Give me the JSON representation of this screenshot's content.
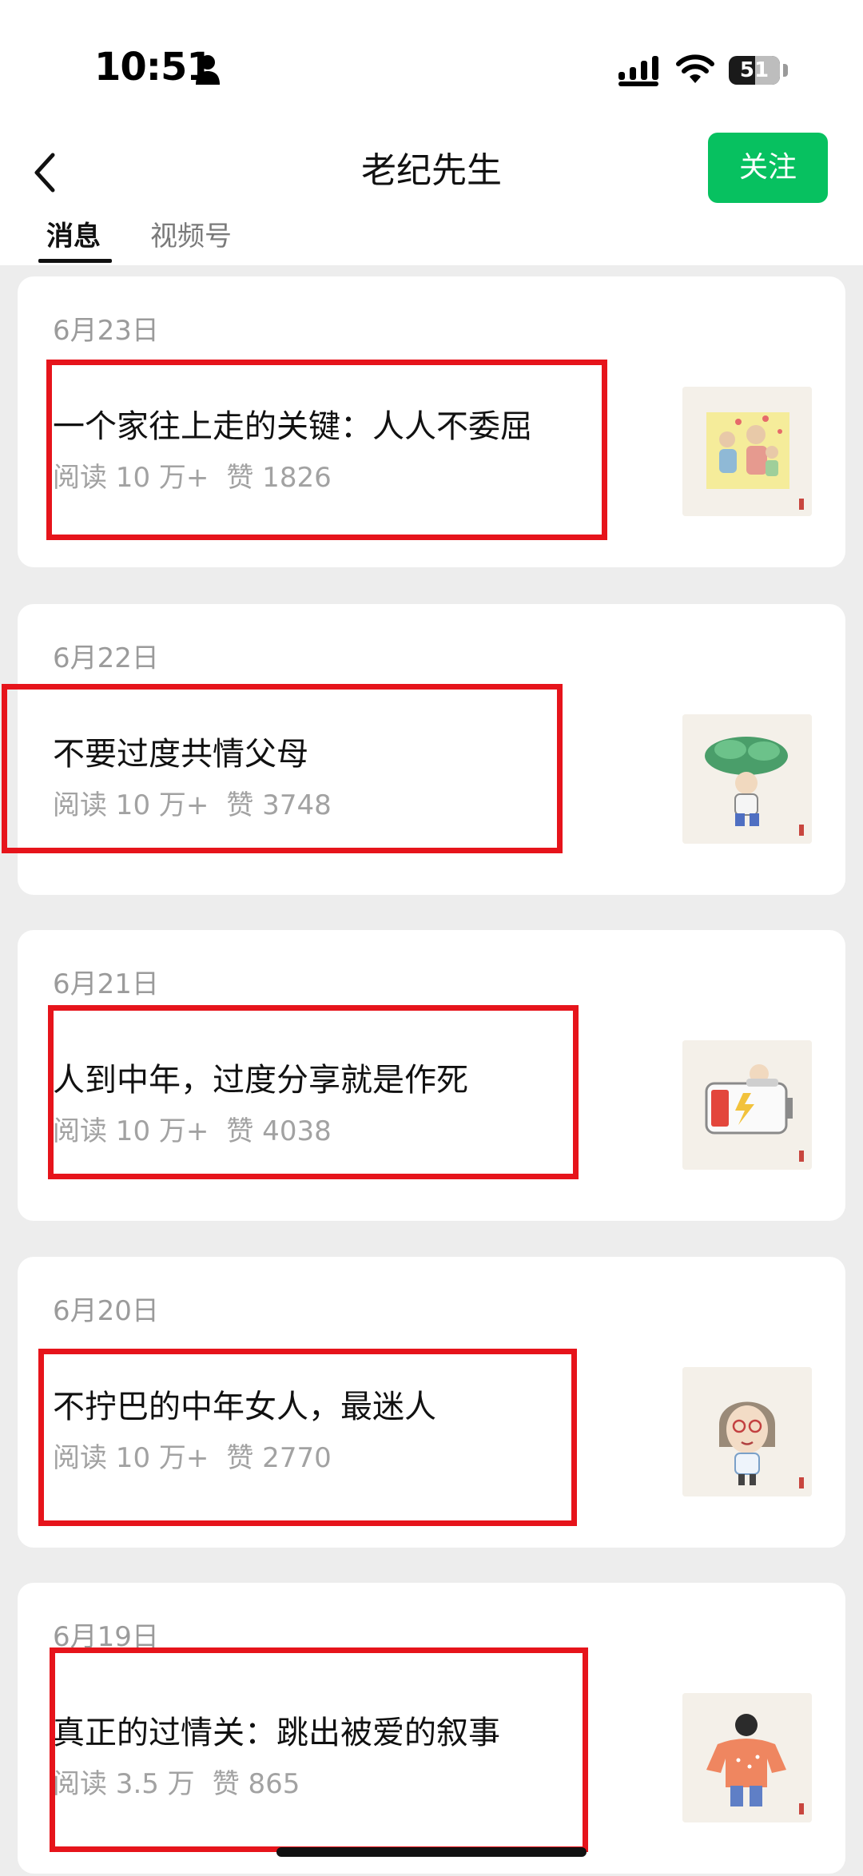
{
  "status_bar": {
    "time": "10:51",
    "battery_percent": "51",
    "battery_level": 0.51,
    "icons": [
      "person-icon",
      "signal-icon",
      "wifi-icon",
      "battery-icon"
    ]
  },
  "header": {
    "back_icon": "chevron-left-icon",
    "title": "老纪先生",
    "follow_label": "关注",
    "accent_color": "#07c160"
  },
  "tabs": [
    {
      "label": "消息",
      "active": true
    },
    {
      "label": "视频号",
      "active": false
    }
  ],
  "articles": [
    {
      "date": "6月23日",
      "title": "一个家往上走的关键：人人不委屈",
      "reads": "阅读 10 万+",
      "likes": "赞 1826",
      "thumbnail_icon": "family-illustration-icon"
    },
    {
      "date": "6月22日",
      "title": "不要过度共情父母",
      "reads": "阅读 10 万+",
      "likes": "赞 3748",
      "thumbnail_icon": "person-carrying-plant-icon"
    },
    {
      "date": "6月21日",
      "title": "人到中年，过度分享就是作死",
      "reads": "阅读 10 万+",
      "likes": "赞 4038",
      "thumbnail_icon": "tired-battery-icon"
    },
    {
      "date": "6月20日",
      "title": "不拧巴的中年女人，最迷人",
      "reads": "阅读 10 万+",
      "likes": "赞 2770",
      "thumbnail_icon": "woman-with-glasses-icon"
    },
    {
      "date": "6月19日",
      "title": "真正的过情关：跳出被爱的叙事",
      "reads": "阅读 3.5 万",
      "likes": "赞 865",
      "thumbnail_icon": "person-in-sweater-icon"
    }
  ],
  "annotation_color": "#e6141b"
}
